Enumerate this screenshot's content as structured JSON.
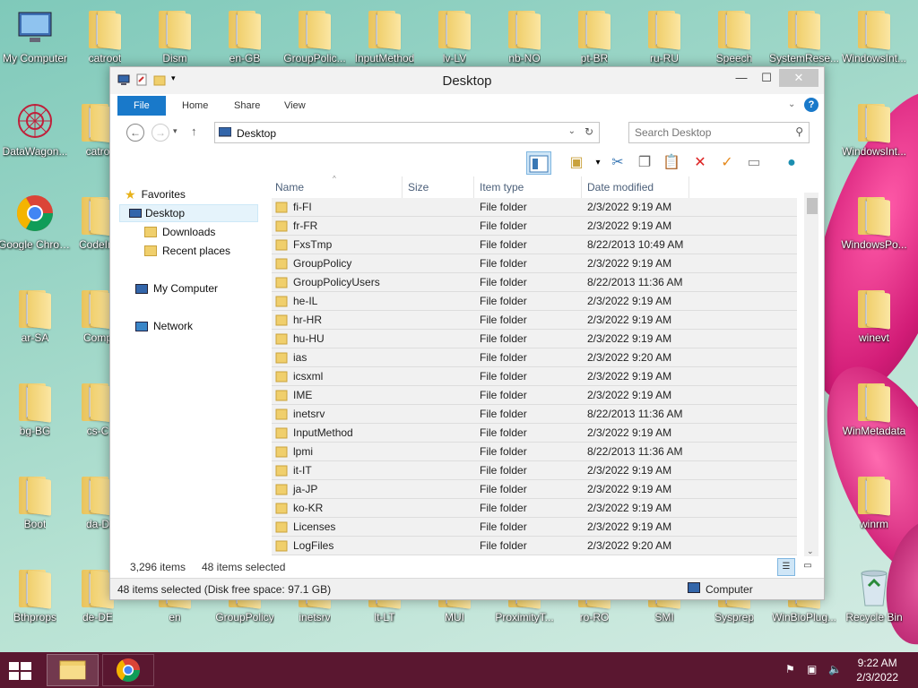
{
  "desktop": {
    "row1": [
      "My Computer",
      "catroot",
      "Dism",
      "en-GB",
      "GroupPolic...",
      "InputMethod",
      "lv-LV",
      "nb-NO",
      "pt-BR",
      "ru-RU",
      "Speech",
      "SystemRese...",
      "WindowsInt..."
    ],
    "col_left": [
      "DataWagon...",
      "Google Chrome",
      "ar-SA",
      "bg-BG",
      "Boot",
      "Bthprops"
    ],
    "col2": [
      "catro",
      "CodeInt",
      "Comp",
      "cs-C",
      "da-D",
      "de-DE"
    ],
    "col_right": [
      "WindowsInt...",
      "WindowsPo...",
      "winevt",
      "WinMetadata",
      "winrm",
      "Recycle Bin"
    ],
    "bottom_row": [
      "en",
      "GroupPolicy",
      "inetsrv",
      "lt-LT",
      "MUI",
      "ProximityT...",
      "ro-RO",
      "SMI",
      "Sysprep",
      "WinBioPlug..."
    ]
  },
  "window": {
    "title": "Desktop",
    "ribbon_tabs": [
      "File",
      "Home",
      "Share",
      "View"
    ],
    "address": "Desktop",
    "search_placeholder": "Search Desktop",
    "nav": {
      "favorites": "Favorites",
      "desktop": "Desktop",
      "downloads": "Downloads",
      "recent": "Recent places",
      "computer": "My Computer",
      "network": "Network"
    },
    "columns": [
      "Name",
      "Size",
      "Item type",
      "Date modified"
    ],
    "rows": [
      {
        "name": "fi-FI",
        "type": "File folder",
        "date": "2/3/2022 9:19 AM"
      },
      {
        "name": "fr-FR",
        "type": "File folder",
        "date": "2/3/2022 9:19 AM"
      },
      {
        "name": "FxsTmp",
        "type": "File folder",
        "date": "8/22/2013 10:49 AM"
      },
      {
        "name": "GroupPolicy",
        "type": "File folder",
        "date": "2/3/2022 9:19 AM"
      },
      {
        "name": "GroupPolicyUsers",
        "type": "File folder",
        "date": "8/22/2013 11:36 AM"
      },
      {
        "name": "he-IL",
        "type": "File folder",
        "date": "2/3/2022 9:19 AM"
      },
      {
        "name": "hr-HR",
        "type": "File folder",
        "date": "2/3/2022 9:19 AM"
      },
      {
        "name": "hu-HU",
        "type": "File folder",
        "date": "2/3/2022 9:19 AM"
      },
      {
        "name": "ias",
        "type": "File folder",
        "date": "2/3/2022 9:20 AM"
      },
      {
        "name": "icsxml",
        "type": "File folder",
        "date": "2/3/2022 9:19 AM"
      },
      {
        "name": "IME",
        "type": "File folder",
        "date": "2/3/2022 9:19 AM"
      },
      {
        "name": "inetsrv",
        "type": "File folder",
        "date": "8/22/2013 11:36 AM"
      },
      {
        "name": "InputMethod",
        "type": "File folder",
        "date": "2/3/2022 9:19 AM"
      },
      {
        "name": "lpmi",
        "type": "File folder",
        "date": "8/22/2013 11:36 AM"
      },
      {
        "name": "it-IT",
        "type": "File folder",
        "date": "2/3/2022 9:19 AM"
      },
      {
        "name": "ja-JP",
        "type": "File folder",
        "date": "2/3/2022 9:19 AM"
      },
      {
        "name": "ko-KR",
        "type": "File folder",
        "date": "2/3/2022 9:19 AM"
      },
      {
        "name": "Licenses",
        "type": "File folder",
        "date": "2/3/2022 9:19 AM"
      },
      {
        "name": "LogFiles",
        "type": "File folder",
        "date": "2/3/2022 9:20 AM"
      }
    ],
    "item_count": "3,296 items",
    "selected_count": "48 items selected",
    "status": "48 items selected (Disk free space: 97.1 GB)",
    "status_location": "Computer"
  },
  "taskbar": {
    "time": "9:22 AM",
    "date": "2/3/2022"
  },
  "colors": {
    "accent": "#1979ca",
    "taskbar": "#5a1730",
    "folder": "#f0cf6c"
  }
}
